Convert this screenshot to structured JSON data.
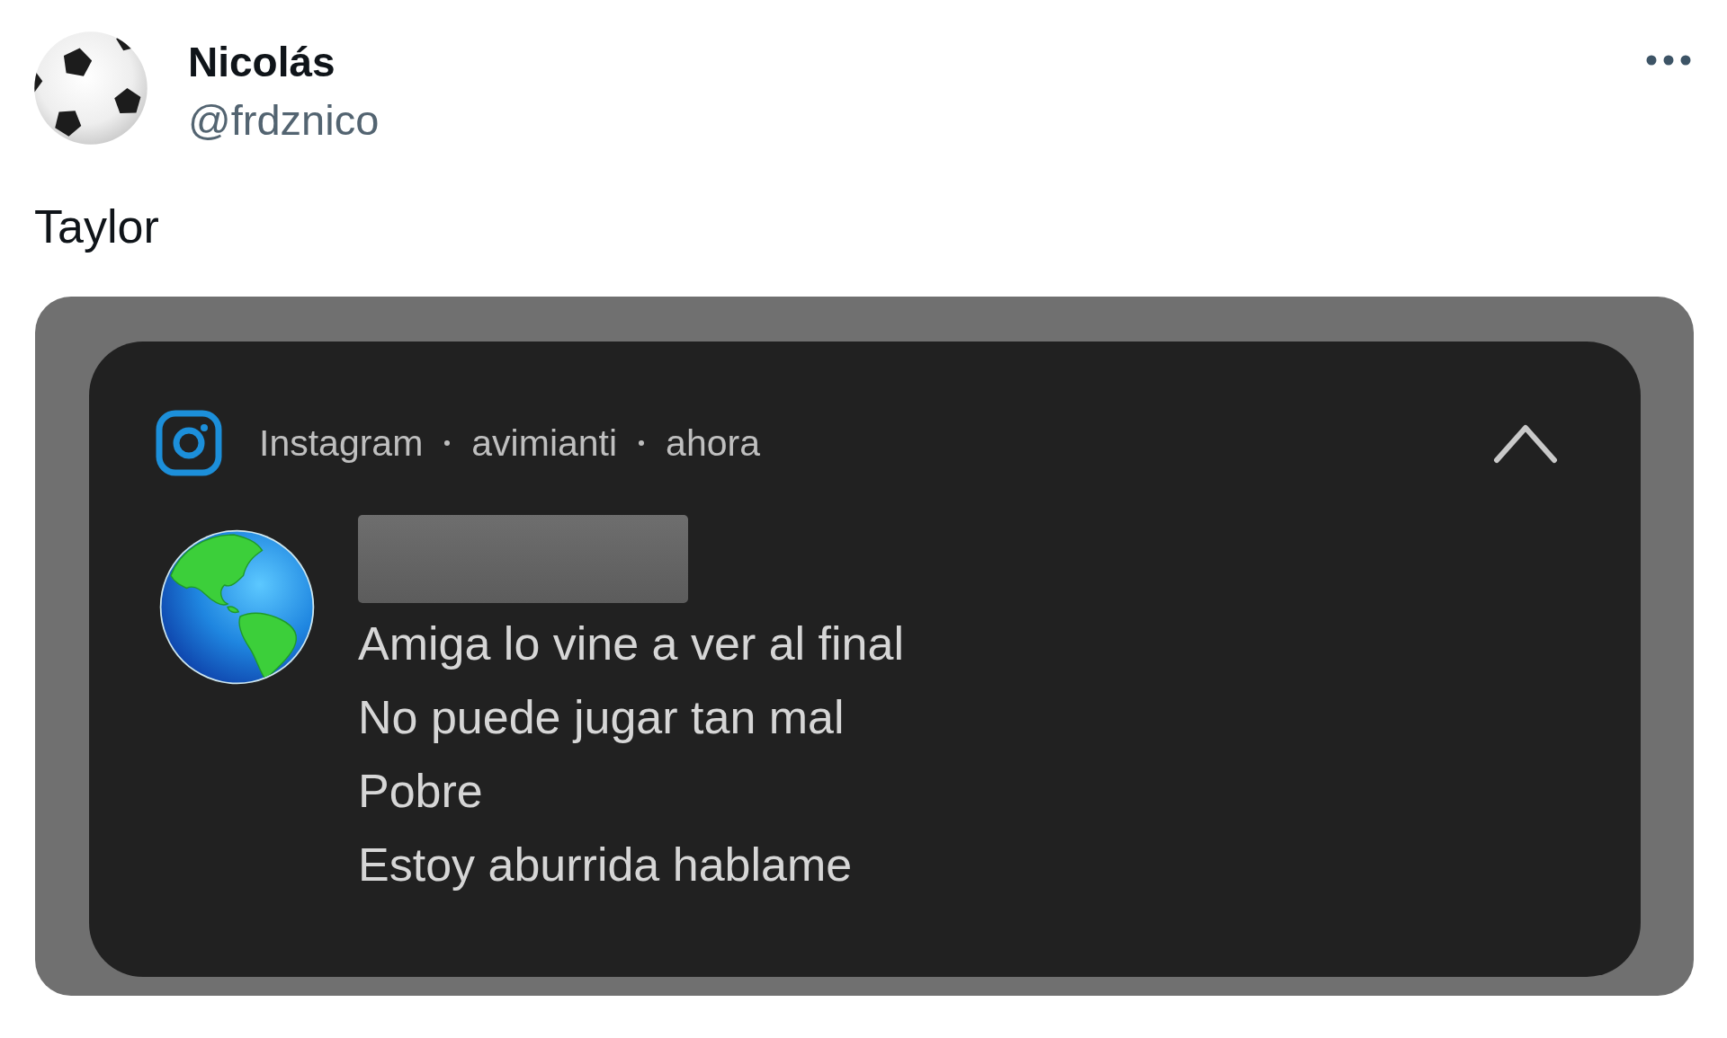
{
  "tweet": {
    "author": {
      "name": "Nicolás",
      "handle": "@frdznico"
    },
    "text": "Taylor",
    "notification": {
      "app": "Instagram",
      "account": "avimianti",
      "time": "ahora",
      "expanded": true,
      "messages": [
        "Amiga lo vine a ver al final",
        "No puede jugar tan mal",
        "Pobre",
        "Estoy aburrida hablame"
      ]
    }
  }
}
